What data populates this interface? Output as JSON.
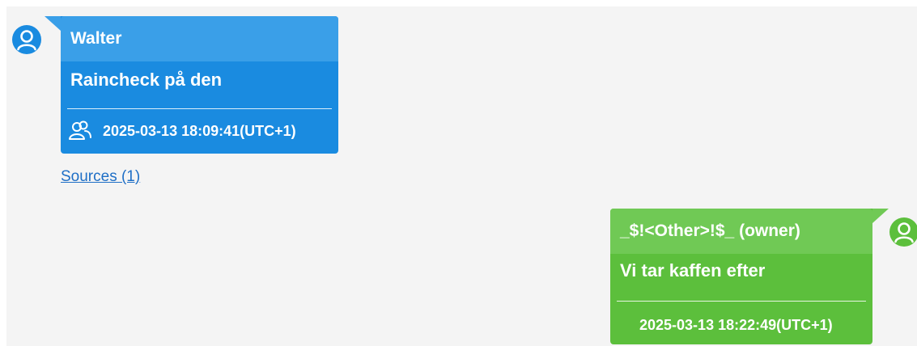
{
  "conversation": {
    "messages": [
      {
        "sender": "Walter",
        "text": "Raincheck på den",
        "timestamp": "2025-03-13 18:09:41(UTC+1)",
        "direction": "incoming",
        "color": "#1a8be0",
        "icon": "participants-icon",
        "sources_link": "Sources (1)"
      },
      {
        "sender": "_$!<Other>!$_ (owner)",
        "text": "Vi tar kaffen efter",
        "timestamp": "2025-03-13 18:22:49(UTC+1)",
        "direction": "outgoing",
        "color": "#5cbf3c"
      }
    ]
  }
}
